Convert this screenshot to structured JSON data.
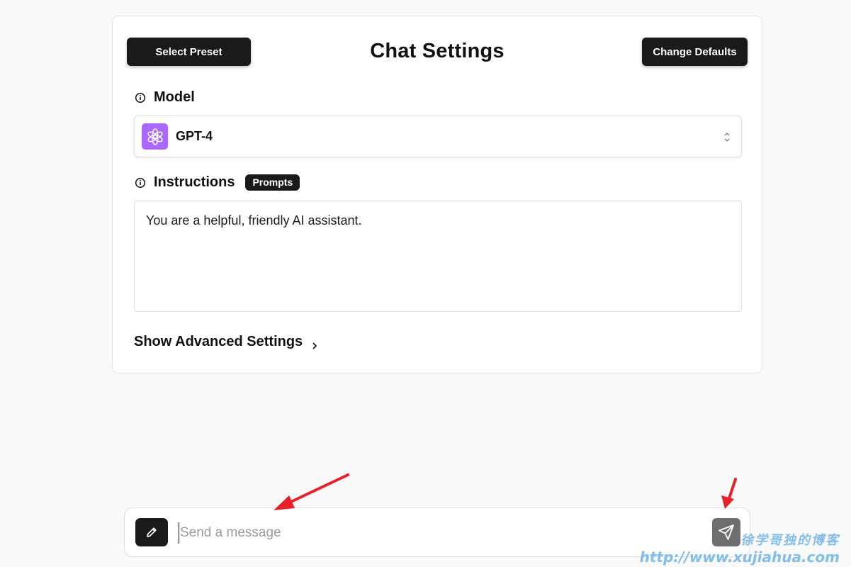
{
  "settings": {
    "title": "Chat Settings",
    "select_preset_label": "Select Preset",
    "change_defaults_label": "Change Defaults",
    "model": {
      "label": "Model",
      "selected": "GPT-4",
      "logo_color": "#ab68ff"
    },
    "instructions": {
      "label": "Instructions",
      "prompts_badge": "Prompts",
      "value": "You are a helpful, friendly AI assistant."
    },
    "advanced_label": "Show Advanced Settings"
  },
  "composer": {
    "placeholder": "Send a message",
    "value": ""
  },
  "watermark": {
    "line1": "徐学哥独的博客",
    "line2": "http://www.xujiahua.com"
  },
  "colors": {
    "annotation_arrow": "#e8202a",
    "button_dark": "#1a1a1a",
    "send_button": "#6e6e6e"
  },
  "icons": {
    "model_heading": "info-icon",
    "instructions_heading": "info-icon",
    "model_logo": "openai-logo-icon",
    "select": "chevron-up-down-icon",
    "advanced": "chevron-right-icon",
    "edit": "pencil-icon",
    "send": "paper-plane-icon"
  }
}
